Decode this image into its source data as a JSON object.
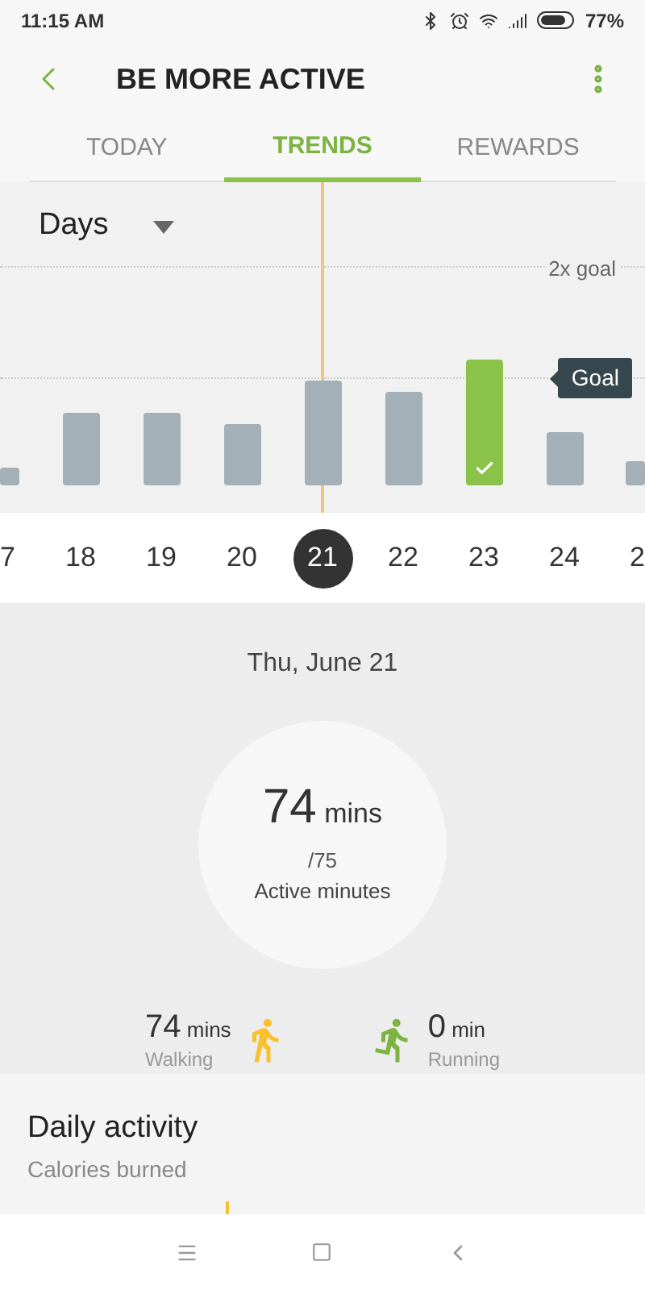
{
  "status_bar": {
    "time": "11:15 AM",
    "battery": "77%"
  },
  "header": {
    "title": "BE MORE ACTIVE"
  },
  "tabs": [
    {
      "label": "TODAY",
      "selected": false
    },
    {
      "label": "TRENDS",
      "selected": true
    },
    {
      "label": "REWARDS",
      "selected": false
    }
  ],
  "period_selector": {
    "value": "Days"
  },
  "chart": {
    "upper_line_label": "2x goal",
    "goal_label": "Goal"
  },
  "days": [
    {
      "label": "7",
      "selected": false,
      "goal_met": false
    },
    {
      "label": "18",
      "selected": false,
      "goal_met": false
    },
    {
      "label": "19",
      "selected": false,
      "goal_met": false
    },
    {
      "label": "20",
      "selected": false,
      "goal_met": false
    },
    {
      "label": "21",
      "selected": true,
      "goal_met": false
    },
    {
      "label": "22",
      "selected": false,
      "goal_met": false
    },
    {
      "label": "23",
      "selected": false,
      "goal_met": true
    },
    {
      "label": "24",
      "selected": false,
      "goal_met": false
    },
    {
      "label": "2",
      "selected": false,
      "goal_met": false
    }
  ],
  "detail": {
    "date": "Thu, June 21",
    "value": "74",
    "unit": "mins",
    "target": "/75",
    "caption": "Active minutes"
  },
  "breakdown": [
    {
      "kind": "walking",
      "value": "74",
      "unit": "mins",
      "label": "Walking"
    },
    {
      "kind": "running",
      "value": "0",
      "unit": "min",
      "label": "Running"
    }
  ],
  "daily_activity": {
    "title": "Daily activity",
    "subtitle": "Calories burned"
  }
}
